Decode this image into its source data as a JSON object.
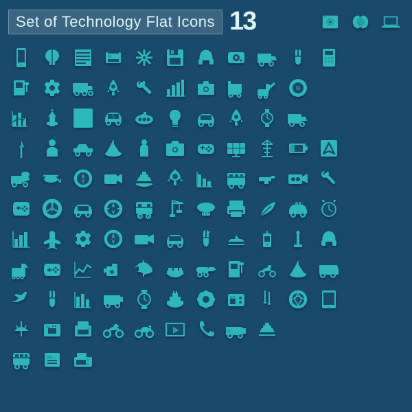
{
  "header": {
    "title": "Set of Technology Flat Icons",
    "number": "13"
  },
  "colors": {
    "bg": "#1a4a6b",
    "icon": "#2ab8b8",
    "title_bg": "rgba(255,255,255,0.15)",
    "title_text": "#e0f4f4"
  }
}
